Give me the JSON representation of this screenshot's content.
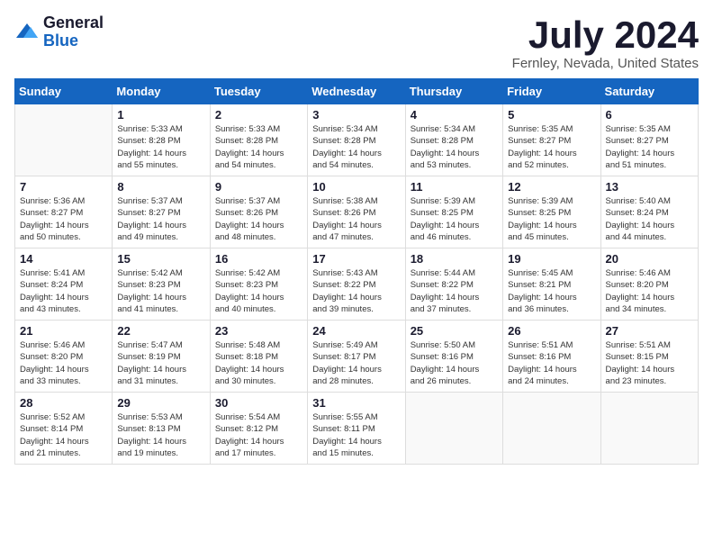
{
  "logo": {
    "general": "General",
    "blue": "Blue"
  },
  "title": "July 2024",
  "subtitle": "Fernley, Nevada, United States",
  "weekdays": [
    "Sunday",
    "Monday",
    "Tuesday",
    "Wednesday",
    "Thursday",
    "Friday",
    "Saturday"
  ],
  "weeks": [
    [
      {
        "day": "",
        "info": ""
      },
      {
        "day": "1",
        "info": "Sunrise: 5:33 AM\nSunset: 8:28 PM\nDaylight: 14 hours\nand 55 minutes."
      },
      {
        "day": "2",
        "info": "Sunrise: 5:33 AM\nSunset: 8:28 PM\nDaylight: 14 hours\nand 54 minutes."
      },
      {
        "day": "3",
        "info": "Sunrise: 5:34 AM\nSunset: 8:28 PM\nDaylight: 14 hours\nand 54 minutes."
      },
      {
        "day": "4",
        "info": "Sunrise: 5:34 AM\nSunset: 8:28 PM\nDaylight: 14 hours\nand 53 minutes."
      },
      {
        "day": "5",
        "info": "Sunrise: 5:35 AM\nSunset: 8:27 PM\nDaylight: 14 hours\nand 52 minutes."
      },
      {
        "day": "6",
        "info": "Sunrise: 5:35 AM\nSunset: 8:27 PM\nDaylight: 14 hours\nand 51 minutes."
      }
    ],
    [
      {
        "day": "7",
        "info": "Sunrise: 5:36 AM\nSunset: 8:27 PM\nDaylight: 14 hours\nand 50 minutes."
      },
      {
        "day": "8",
        "info": "Sunrise: 5:37 AM\nSunset: 8:27 PM\nDaylight: 14 hours\nand 49 minutes."
      },
      {
        "day": "9",
        "info": "Sunrise: 5:37 AM\nSunset: 8:26 PM\nDaylight: 14 hours\nand 48 minutes."
      },
      {
        "day": "10",
        "info": "Sunrise: 5:38 AM\nSunset: 8:26 PM\nDaylight: 14 hours\nand 47 minutes."
      },
      {
        "day": "11",
        "info": "Sunrise: 5:39 AM\nSunset: 8:25 PM\nDaylight: 14 hours\nand 46 minutes."
      },
      {
        "day": "12",
        "info": "Sunrise: 5:39 AM\nSunset: 8:25 PM\nDaylight: 14 hours\nand 45 minutes."
      },
      {
        "day": "13",
        "info": "Sunrise: 5:40 AM\nSunset: 8:24 PM\nDaylight: 14 hours\nand 44 minutes."
      }
    ],
    [
      {
        "day": "14",
        "info": "Sunrise: 5:41 AM\nSunset: 8:24 PM\nDaylight: 14 hours\nand 43 minutes."
      },
      {
        "day": "15",
        "info": "Sunrise: 5:42 AM\nSunset: 8:23 PM\nDaylight: 14 hours\nand 41 minutes."
      },
      {
        "day": "16",
        "info": "Sunrise: 5:42 AM\nSunset: 8:23 PM\nDaylight: 14 hours\nand 40 minutes."
      },
      {
        "day": "17",
        "info": "Sunrise: 5:43 AM\nSunset: 8:22 PM\nDaylight: 14 hours\nand 39 minutes."
      },
      {
        "day": "18",
        "info": "Sunrise: 5:44 AM\nSunset: 8:22 PM\nDaylight: 14 hours\nand 37 minutes."
      },
      {
        "day": "19",
        "info": "Sunrise: 5:45 AM\nSunset: 8:21 PM\nDaylight: 14 hours\nand 36 minutes."
      },
      {
        "day": "20",
        "info": "Sunrise: 5:46 AM\nSunset: 8:20 PM\nDaylight: 14 hours\nand 34 minutes."
      }
    ],
    [
      {
        "day": "21",
        "info": "Sunrise: 5:46 AM\nSunset: 8:20 PM\nDaylight: 14 hours\nand 33 minutes."
      },
      {
        "day": "22",
        "info": "Sunrise: 5:47 AM\nSunset: 8:19 PM\nDaylight: 14 hours\nand 31 minutes."
      },
      {
        "day": "23",
        "info": "Sunrise: 5:48 AM\nSunset: 8:18 PM\nDaylight: 14 hours\nand 30 minutes."
      },
      {
        "day": "24",
        "info": "Sunrise: 5:49 AM\nSunset: 8:17 PM\nDaylight: 14 hours\nand 28 minutes."
      },
      {
        "day": "25",
        "info": "Sunrise: 5:50 AM\nSunset: 8:16 PM\nDaylight: 14 hours\nand 26 minutes."
      },
      {
        "day": "26",
        "info": "Sunrise: 5:51 AM\nSunset: 8:16 PM\nDaylight: 14 hours\nand 24 minutes."
      },
      {
        "day": "27",
        "info": "Sunrise: 5:51 AM\nSunset: 8:15 PM\nDaylight: 14 hours\nand 23 minutes."
      }
    ],
    [
      {
        "day": "28",
        "info": "Sunrise: 5:52 AM\nSunset: 8:14 PM\nDaylight: 14 hours\nand 21 minutes."
      },
      {
        "day": "29",
        "info": "Sunrise: 5:53 AM\nSunset: 8:13 PM\nDaylight: 14 hours\nand 19 minutes."
      },
      {
        "day": "30",
        "info": "Sunrise: 5:54 AM\nSunset: 8:12 PM\nDaylight: 14 hours\nand 17 minutes."
      },
      {
        "day": "31",
        "info": "Sunrise: 5:55 AM\nSunset: 8:11 PM\nDaylight: 14 hours\nand 15 minutes."
      },
      {
        "day": "",
        "info": ""
      },
      {
        "day": "",
        "info": ""
      },
      {
        "day": "",
        "info": ""
      }
    ]
  ]
}
